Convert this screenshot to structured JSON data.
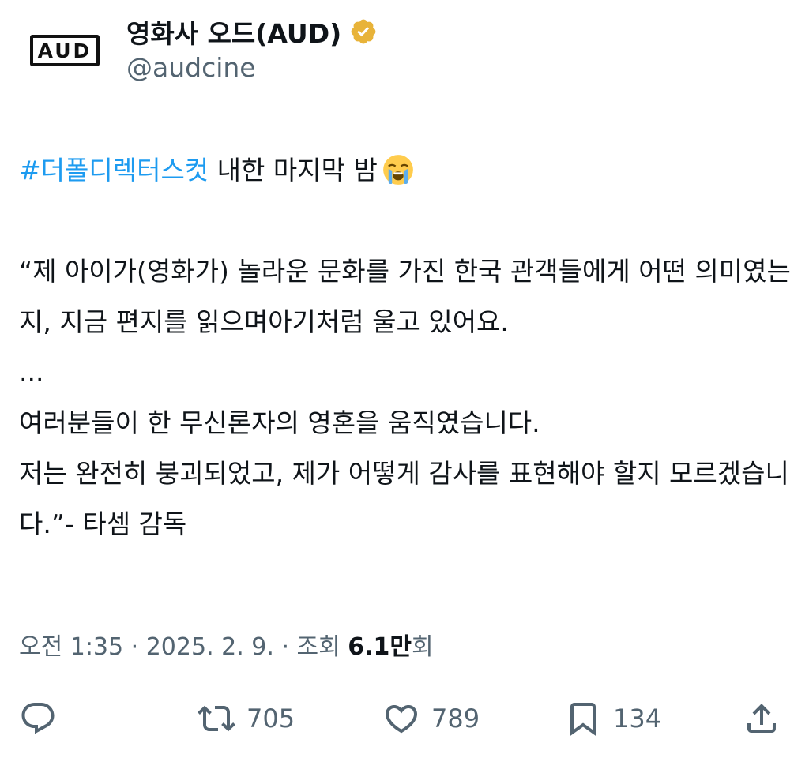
{
  "author": {
    "avatar_text": "AUD",
    "display_name": "영화사 오드(AUD)",
    "handle": "@audcine",
    "verified_color": "#e8b339"
  },
  "tweet": {
    "hashtag": "#더폴디렉터스컷",
    "headline_rest": " 내한 마지막 밤",
    "emoji": "loudly-crying-face",
    "quote_line1": "“제 아이가(영화가) 놀라운 문화를 가진 한국 관객들에게 어떤 의미였는지, 지금 편지를 읽으며아기처럼 울고 있어요.",
    "ellipsis": "...",
    "line2": "여러분들이 한 무신론자의 영혼을 움직였습니다.",
    "line3": "저는 완전히 붕괴되었고, 제가 어떻게 감사를 표현해야 할지 모르겠습니다.”- 타셈 감독"
  },
  "meta": {
    "time": "오전 1:35",
    "sep": " · ",
    "date": "2025. 2. 9.",
    "views_label": "조회 ",
    "views_count": "6.1만",
    "views_suffix": "회"
  },
  "actions": {
    "reply_icon": "reply-icon",
    "retweet_count": "705",
    "like_count": "789",
    "bookmark_count": "134",
    "share_icon": "share-icon"
  },
  "colors": {
    "link": "#1d9bf0",
    "secondary": "#536471",
    "text": "#0f1419"
  }
}
